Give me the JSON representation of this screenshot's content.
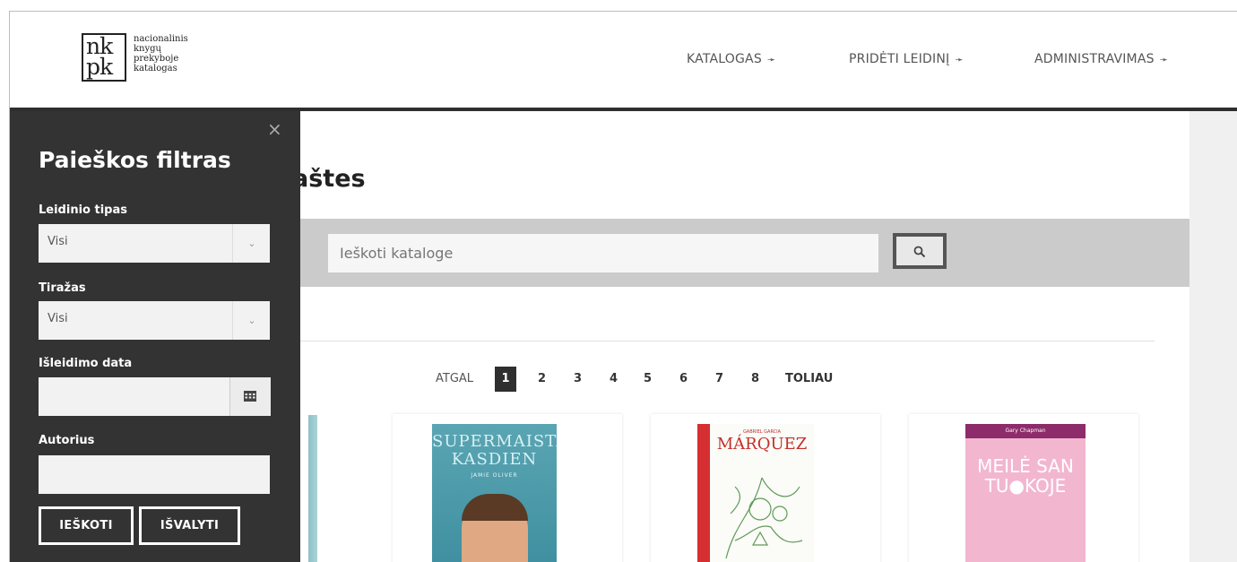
{
  "logo": {
    "mark_top": "nk",
    "mark_bottom": "pk",
    "words": [
      "nacionalinis",
      "knygų",
      "prekyboje",
      "katalogas"
    ]
  },
  "nav": [
    {
      "label": "KATALOGAS"
    },
    {
      "label": "PRIDĖTI LEIDINĮ"
    },
    {
      "label": "ADMINISTRAVIMAS"
    }
  ],
  "page": {
    "title": "aštes"
  },
  "search": {
    "placeholder": "Ieškoti kataloge"
  },
  "pagination": {
    "prev": "ATGAL",
    "pages": [
      "1",
      "2",
      "3",
      "4",
      "5",
      "6",
      "7",
      "8"
    ],
    "current": "1",
    "next": "TOLIAU"
  },
  "books": [
    {
      "cover_title": "SUPERMAISTAS KASDIEN",
      "cover_author": "JAMIE OLIVER"
    },
    {
      "cover_title": "MÁRQUEZ",
      "cover_author": "GABRIEL GARCIA"
    },
    {
      "cover_title": "MEILĖ SAN TU●KOJE",
      "cover_author": "Gary Chapman"
    }
  ],
  "filter": {
    "close": "×",
    "title": "Paieškos filtras",
    "type_label": "Leidinio tipas",
    "type_value": "Visi",
    "print_label": "Tiražas",
    "print_value": "Visi",
    "date_label": "Išleidimo data",
    "author_label": "Autorius",
    "search_button": "IEŠKOTI",
    "clear_button": "IŠVALYTI"
  },
  "colors": {
    "sidebar_bg": "#333333",
    "header_border": "#2e2e2e",
    "search_band": "#cbcbcb",
    "active_page": "#2f2f2f"
  }
}
